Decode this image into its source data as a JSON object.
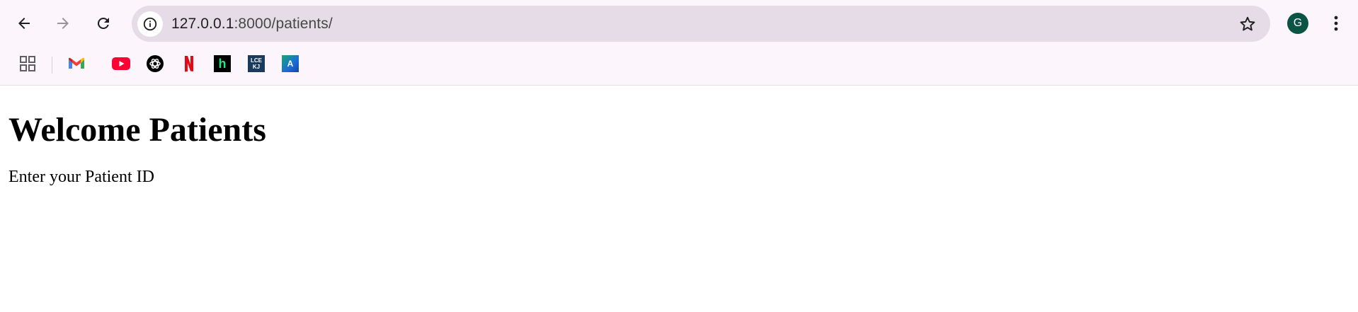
{
  "browser": {
    "url_host": "127.0.0.1",
    "url_path": ":8000/patients/",
    "profile_initial": "G",
    "icons": {
      "back": "arrow-left-icon",
      "forward": "arrow-right-icon",
      "reload": "reload-icon",
      "site_info": "info-icon",
      "bookmark": "star-icon",
      "menu": "kebab-menu-icon"
    },
    "bookmarks": [
      {
        "name": "apps",
        "icon": "apps-grid-icon"
      },
      {
        "name": "gmail",
        "icon": "gmail-icon"
      },
      {
        "name": "youtube",
        "icon": "youtube-icon"
      },
      {
        "name": "chatgpt",
        "icon": "chatgpt-icon"
      },
      {
        "name": "netflix",
        "icon": "netflix-icon"
      },
      {
        "name": "hulu",
        "icon": "hulu-h-icon"
      },
      {
        "name": "lcekj",
        "icon": "lcekj-icon"
      },
      {
        "name": "a-app",
        "icon": "a-logo-icon"
      }
    ],
    "bookmark_texts": {
      "hulu": "h",
      "lcekj_top": "LCE",
      "lcekj_bottom": "KJ",
      "a_logo": "A"
    },
    "colors": {
      "chrome_bg": "#fcf5fc",
      "omnibox_bg": "#e6dce8",
      "avatar_bg": "#0b5345",
      "youtube_red": "#ff0033",
      "netflix_red": "#e50914",
      "hulu_green": "#1ce783"
    }
  },
  "page": {
    "heading": "Welcome Patients",
    "prompt": "Enter your Patient ID"
  }
}
